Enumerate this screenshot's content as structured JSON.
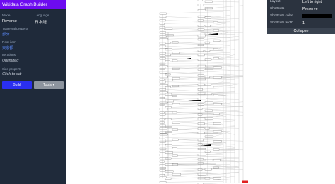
{
  "app": {
    "title": "Wikidata Graph Builder"
  },
  "settings": {
    "mode_label": "Mode",
    "mode_value": "Reverse",
    "language_label": "Language",
    "language_value": "日本語",
    "traversal_label": "Traversal property",
    "traversal_value": "部分",
    "root_label": "Root item",
    "root_value": "東京都",
    "iterations_label": "Iterations",
    "iterations_value": "Unlimited",
    "size_label": "Size property",
    "size_value": "Click to set"
  },
  "actions": {
    "build_label": "Build",
    "tools_label": "Tools ▾"
  },
  "options": {
    "layout_label": "Layout",
    "layout_value": "Left to right",
    "shortcuts_label": "Shortcuts",
    "shortcuts_value": "Preserve",
    "shortcuts_color_label": "Shortcuts color",
    "shortcuts_color": "#000000",
    "shortcuts_width_label": "Shortcuts width",
    "shortcuts_width_value": "1",
    "collapse_label": "Collapse"
  },
  "graph": {
    "node_label": "",
    "root_highlight_color": "#e02020"
  }
}
